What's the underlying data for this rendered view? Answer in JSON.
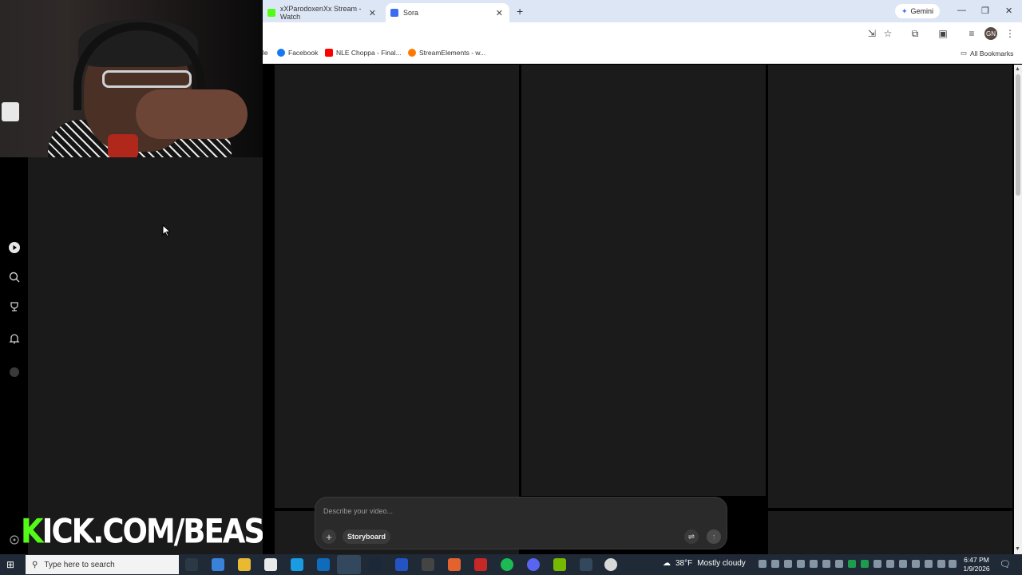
{
  "browser": {
    "tabs": [
      {
        "label": "xXParodoxenXx Stream - Watch",
        "favicon_color": "#53fc18"
      },
      {
        "label": "Sora",
        "favicon_color": "#3a6df0"
      }
    ],
    "gemini_label": "Gemini",
    "bookmarks": [
      {
        "label": "le",
        "color": "#888888"
      },
      {
        "label": "Facebook",
        "color": "#1877f2"
      },
      {
        "label": "NLE Choppa - Final...",
        "color": "#ff0000"
      },
      {
        "label": "StreamElements - w...",
        "color": "#ff7a00"
      }
    ],
    "all_bookmarks_label": "All Bookmarks",
    "avatar_initials": "GN"
  },
  "sora": {
    "composer": {
      "placeholder": "Describe your video...",
      "storyboard_label": "Storyboard"
    }
  },
  "stream": {
    "banner_k": "K",
    "banner_rest": "ICK.COM/BEASTK"
  },
  "taskbar": {
    "search_placeholder": "Type here to search",
    "weather_temp": "38°F",
    "weather_desc": "Mostly cloudy",
    "time": "6:47 PM",
    "date": "1/9/2026"
  },
  "colors": {
    "kick_green": "#53fc18",
    "sora_panel": "#1b1b1b",
    "taskbar_bg": "#1f2a36"
  }
}
